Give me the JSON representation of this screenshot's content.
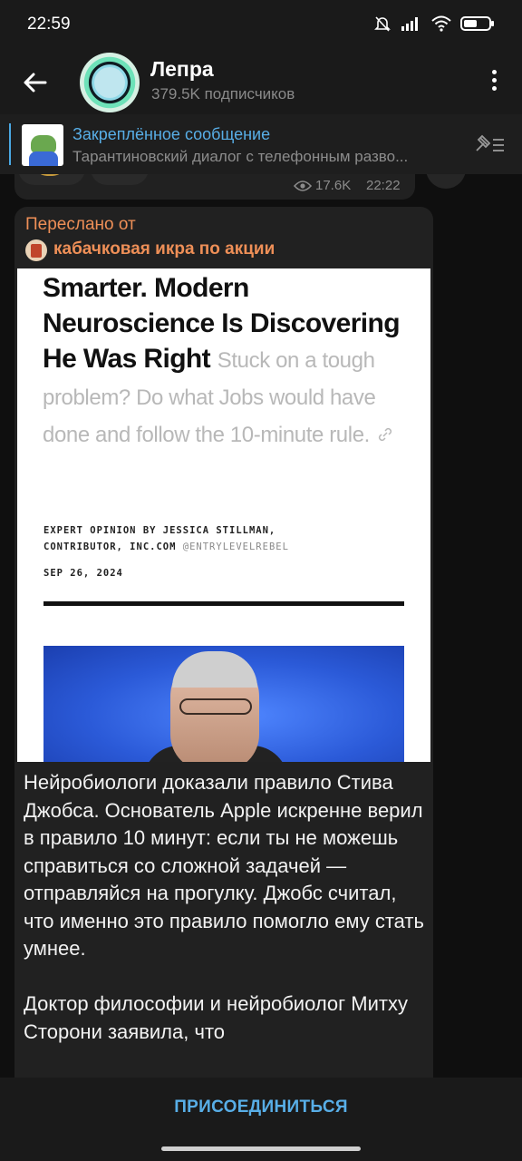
{
  "status_bar": {
    "time": "22:59",
    "icons": [
      "bell-muted-icon",
      "signal-icon",
      "wifi-icon",
      "battery-icon"
    ]
  },
  "header": {
    "title": "Лепра",
    "subtitle": "379.5K подписчиков"
  },
  "pinned": {
    "label": "Закреплённое сообщение",
    "text": "Тарантиновский диалог с телефонным разво..."
  },
  "previous_message": {
    "views": "17.6K",
    "time": "22:22"
  },
  "message": {
    "forwarded_label": "Переслано от",
    "forwarded_from": "кабачковая икра по акции",
    "image": {
      "headline": "Smarter. Modern Neuroscience Is Discovering He Was Right",
      "subheadline": "Stuck on a tough problem? Do what Jobs would have done and follow the 10-minute rule.",
      "byline_line1": "EXPERT OPINION BY JESSICA STILLMAN,",
      "byline_line2": "CONTRIBUTOR, INC.COM",
      "byline_handle": "@ENTRYLEVELREBEL",
      "date": "SEP 26, 2024"
    },
    "text": "Нейробиологи доказали правило Стива Джобса. Основатель Apple искренне верил в правило 10 минут: если ты не можешь справиться со сложной задачей — отправляйся на прогулку. Джобс считал, что именно это правило помогло ему стать умнее.\n\nДоктор философии и нейробиолог Митху Сторони заявила, что"
  },
  "bottom": {
    "join_label": "ПРИСОЕДИНИТЬСЯ"
  },
  "colors": {
    "accent": "#58aee7",
    "forward": "#ee8f57",
    "bubble": "#212121",
    "background": "#0f0f0f"
  }
}
